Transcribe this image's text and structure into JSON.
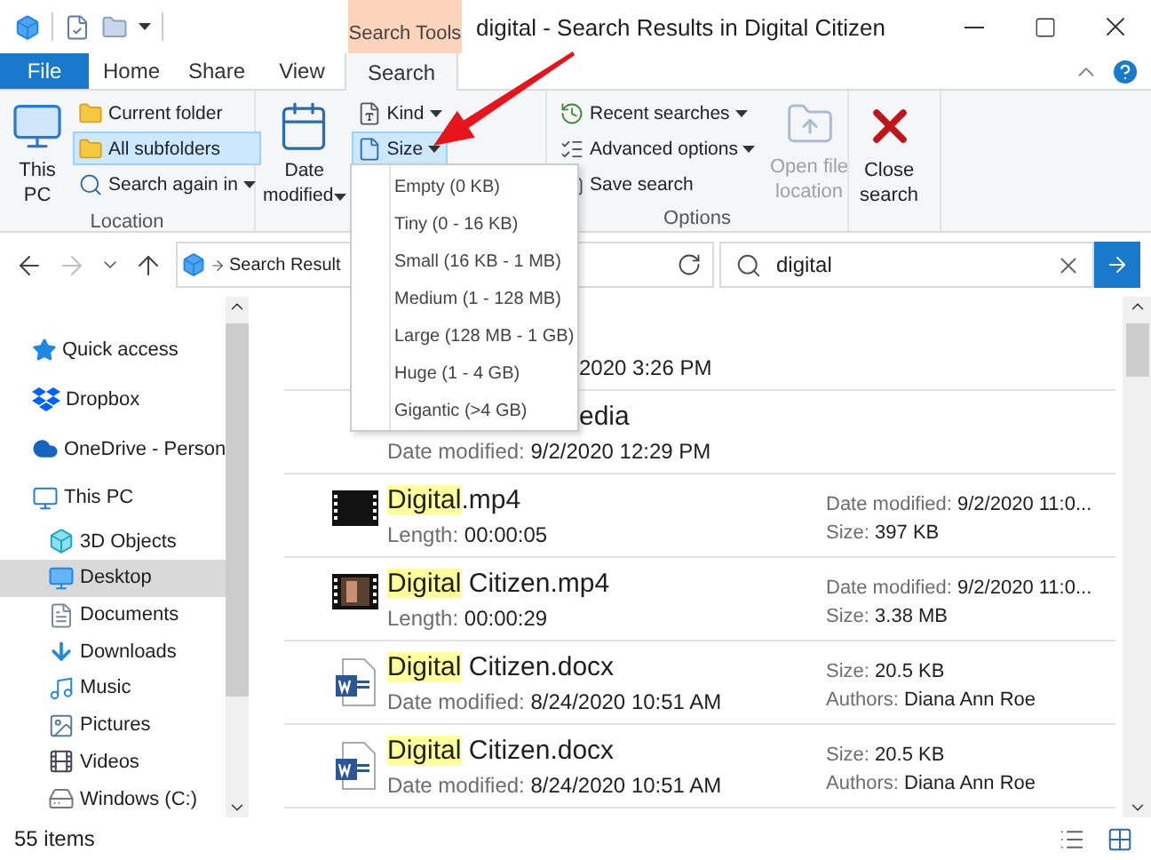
{
  "title_bar": {
    "contextual_tab": "Search Tools",
    "title": "digital - Search Results in Digital Citizen"
  },
  "ribbon_tabs": [
    {
      "label": "File",
      "kind": "file",
      "selected": false
    },
    {
      "label": "Home",
      "kind": "tab",
      "selected": false
    },
    {
      "label": "Share",
      "kind": "tab",
      "selected": false
    },
    {
      "label": "View",
      "kind": "tab",
      "selected": false
    },
    {
      "label": "Search",
      "kind": "tab",
      "selected": true
    }
  ],
  "ribbon": {
    "location": {
      "label": "Location",
      "this_pc": [
        "This",
        "PC"
      ],
      "current_folder": {
        "label": "Current folder",
        "selected": false
      },
      "all_subfolders": {
        "label": "All subfolders",
        "selected": true
      },
      "search_again": "Search again in"
    },
    "refine": {
      "date_modified": [
        "Date",
        "modified"
      ],
      "kind": {
        "label": "Kind",
        "selected": false
      },
      "size": {
        "label": "Size",
        "selected": true
      }
    },
    "options": {
      "label": "Options",
      "recent": "Recent searches",
      "advanced": "Advanced options",
      "save": "Save search",
      "open_location": {
        "lines": [
          "Open file",
          "location"
        ],
        "disabled": true
      }
    },
    "close": [
      "Close",
      "search"
    ]
  },
  "size_menu": [
    "Empty (0 KB)",
    "Tiny (0 - 16 KB)",
    "Small (16 KB - 1 MB)",
    "Medium (1 - 128 MB)",
    "Large (128 MB - 1 GB)",
    "Huge (1 - 4 GB)",
    "Gigantic (>4 GB)"
  ],
  "address_bar": {
    "path": "Search Result",
    "forward_disabled": true
  },
  "search": {
    "value": "digital"
  },
  "navigation": [
    {
      "label": "Quick access",
      "selected": false
    },
    {
      "label": "Dropbox",
      "selected": false
    },
    {
      "label": "OneDrive - Person",
      "selected": false
    },
    {
      "label": "This PC",
      "selected": false,
      "children": [
        {
          "label": "3D Objects",
          "selected": false
        },
        {
          "label": "Desktop",
          "selected": true
        },
        {
          "label": "Documents",
          "selected": false
        },
        {
          "label": "Downloads",
          "selected": false
        },
        {
          "label": "Music",
          "selected": false
        },
        {
          "label": "Pictures",
          "selected": false
        },
        {
          "label": "Videos",
          "selected": false
        },
        {
          "label": "Windows (C:)",
          "selected": false
        }
      ]
    }
  ],
  "results": [
    {
      "kind": "partial",
      "line_2_tail": "2020 3:26 PM"
    },
    {
      "kind": "partial",
      "name_tail": "edia",
      "details": [
        {
          "label": "Date modified:",
          "value": "9/2/2020 12:29 PM"
        }
      ]
    },
    {
      "kind": "video",
      "name": {
        "match": "Digital",
        "rest": ".mp4"
      },
      "details": [
        {
          "label": "Length:",
          "value": "00:00:05"
        }
      ],
      "right": [
        {
          "label": "Date modified:",
          "value": "9/2/2020 11:0..."
        },
        {
          "label": "Size:",
          "value": "397 KB"
        }
      ]
    },
    {
      "kind": "clip",
      "name": {
        "match": "Digital",
        "rest": " Citizen.mp4"
      },
      "details": [
        {
          "label": "Length:",
          "value": "00:00:29"
        }
      ],
      "right": [
        {
          "label": "Date modified:",
          "value": "9/2/2020 11:0..."
        },
        {
          "label": "Size:",
          "value": "3.38 MB"
        }
      ]
    },
    {
      "kind": "document",
      "name": {
        "match": "Digital",
        "rest": " Citizen.docx"
      },
      "details": [
        {
          "label": "Date modified:",
          "value": "8/24/2020 10:51 AM"
        }
      ],
      "right": [
        {
          "label": "Size:",
          "value": "20.5 KB"
        },
        {
          "label": "Authors:",
          "value": "Diana Ann Roe"
        }
      ]
    },
    {
      "kind": "document",
      "name": {
        "match": "Digital",
        "rest": " Citizen.docx"
      },
      "details": [
        {
          "label": "Date modified:",
          "value": "8/24/2020 10:51 AM"
        }
      ],
      "right": [
        {
          "label": "Size:",
          "value": "20.5 KB"
        },
        {
          "label": "Authors:",
          "value": "Diana Ann Roe"
        }
      ]
    }
  ],
  "status_bar": {
    "count": "55 items"
  }
}
